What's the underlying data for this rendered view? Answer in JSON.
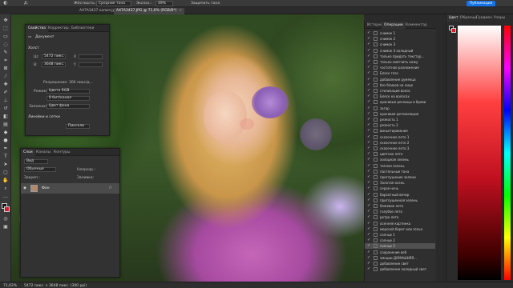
{
  "options_bar": {
    "brush_label": "Д:",
    "hardness_label": "Жёсткость:",
    "hardness_value": "Средние тона",
    "exposure_label": "Экспоз.:",
    "exposure_value": "49%",
    "protect_label": "Защитить тона"
  },
  "tabs": [
    {
      "label": "A47A3437 копия.jpg @ 60,7% (RGB/8*)",
      "active": false
    },
    {
      "label": "A47A3437.JPG @ 71,6% (RGB/8*)",
      "active": true
    }
  ],
  "publish_label": "Публикация",
  "properties": {
    "tabs": [
      "Свойства",
      "Корректир.",
      "Библиотеки"
    ],
    "doc_label": "Документ",
    "canvas_label": "Холст",
    "w_label": "Ш:",
    "w_value": "5472 пикс.",
    "h_label": "В:",
    "h_value": "3648 пикс.",
    "x_label": "X",
    "y_label": "Y",
    "resolution": "Разрешение: 300 пикс/д...",
    "mode_label": "Режим",
    "mode_value": "Цвета RGB",
    "bit_value": "8 бит/канал",
    "fill_label": "Заполнить",
    "fill_value": "Цвет фона",
    "rulers_label": "Линейки и сетки",
    "units_value": "Пиксели"
  },
  "layers": {
    "tabs": [
      "Слои",
      "Каналы",
      "Контуры"
    ],
    "kind_label": "Вид",
    "mode_value": "Обычные",
    "opacity_label": "Непрозр.:",
    "lock_label": "Закреп.:",
    "fill_label": "Заливка:",
    "layer_name": "Фон"
  },
  "history": {
    "tabs": [
      "История",
      "Операции",
      "Комментар"
    ],
    "items": [
      "снимок 1",
      "снимок 2",
      "снимок 3",
      "снимок 4 холодный",
      "только придать текстур...",
      "только смягчить кожу",
      "частотное разложение",
      "Блеск глаз",
      "добавление румянца",
      "без бликов на лице",
      "стилизация волос",
      "Блеск на волосах",
      "красивые ресницы и брови",
      "загар",
      "красивая детализация",
      "резкость 1",
      "резкость 2",
      "виньетирование",
      "сказочное лето 1",
      "сказочное лето 2",
      "сказочное лето 3",
      "цветное лето",
      "холодная зелень",
      "теплая зелень",
      "пастельные тона",
      "приглушение зелени",
      "Золотая осень",
      "серая ночь",
      "бархатный вечер",
      "приглушенная зелень",
      "бежевое лето",
      "голубое лето",
      "ретро лето",
      "осенняя картинка",
      "морской берег или зелье",
      "солнце 1",
      "солнце 2",
      "солнце 3",
      "сохранение веб",
      "эмоции ДОМАШНЯЯ...",
      "добавление свет",
      "добавление холодный свет"
    ],
    "selected_index": 37
  },
  "color_panel": {
    "tabs": [
      "Цвет",
      "Образцы",
      "Градиен",
      "Узоры"
    ]
  },
  "status": {
    "zoom": "71,62%",
    "doc_size": "5472 пикс. x 3648 пикс. (300 ppi)"
  }
}
